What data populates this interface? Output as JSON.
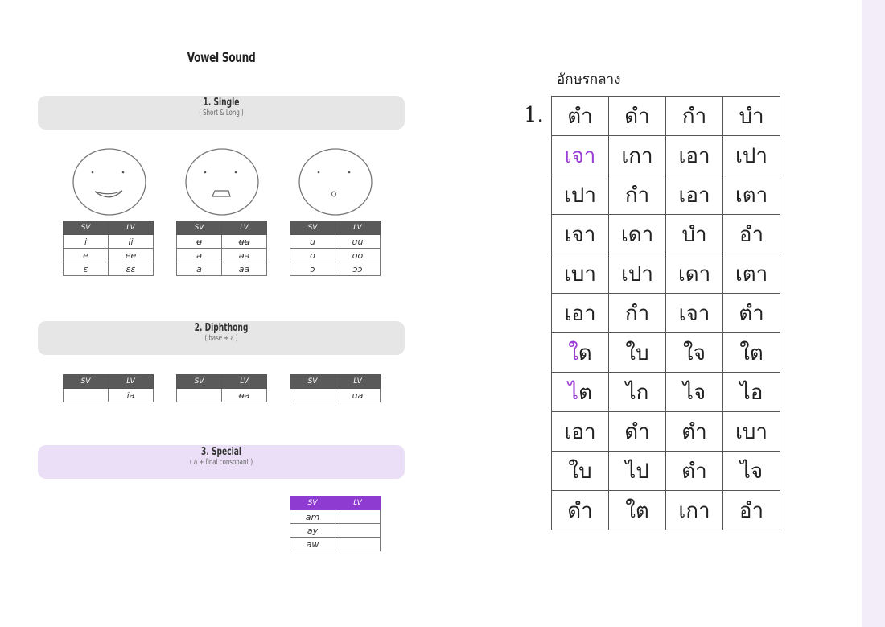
{
  "left": {
    "title": "Vowel Sound",
    "sections": [
      {
        "title": "1. Single",
        "subtitle": "( Short & Long )"
      },
      {
        "title": "2. Diphthong",
        "subtitle": "( base + a )"
      },
      {
        "title": "3. Special",
        "subtitle": "( a + final consonant )"
      }
    ],
    "single_tables": [
      {
        "header": [
          "SV",
          "LV"
        ],
        "rows": [
          [
            "i",
            "ii"
          ],
          [
            "e",
            "ee"
          ],
          [
            "ɛ",
            "ɛɛ"
          ]
        ]
      },
      {
        "header": [
          "SV",
          "LV"
        ],
        "rows": [
          [
            "ʉ",
            "ʉʉ"
          ],
          [
            "ə",
            "əə"
          ],
          [
            "a",
            "aa"
          ]
        ]
      },
      {
        "header": [
          "SV",
          "LV"
        ],
        "rows": [
          [
            "u",
            "uu"
          ],
          [
            "o",
            "oo"
          ],
          [
            "ɔ",
            "ɔɔ"
          ]
        ]
      }
    ],
    "diphthong_tables": [
      {
        "header": [
          "SV",
          "LV"
        ],
        "rows": [
          [
            "",
            "ia"
          ]
        ]
      },
      {
        "header": [
          "SV",
          "LV"
        ],
        "rows": [
          [
            "",
            "ʉa"
          ]
        ]
      },
      {
        "header": [
          "SV",
          "LV"
        ],
        "rows": [
          [
            "",
            "ua"
          ]
        ]
      }
    ],
    "special_table": {
      "header": [
        "SV",
        "LV"
      ],
      "rows": [
        [
          "am",
          ""
        ],
        [
          "ay",
          ""
        ],
        [
          "aw",
          ""
        ]
      ]
    }
  },
  "right": {
    "heading": "อักษรกลาง",
    "exercise_number": "1.",
    "grid": [
      [
        [
          "ต",
          "ำ"
        ],
        "ดำ",
        "กำ",
        "บำ"
      ],
      [
        [
          "",
          "เ",
          "จา"
        ],
        "เกา",
        "เอา",
        "เปา"
      ],
      [
        "เปา",
        "กำ",
        "เอา",
        "เตา"
      ],
      [
        "เจา",
        "เดา",
        "บำ",
        "อำ"
      ],
      [
        "เบา",
        "เปา",
        "เดา",
        "เตา"
      ],
      [
        "เอา",
        "กำ",
        "เจา",
        "ตำ"
      ],
      [
        [
          "",
          "ใ",
          "ด"
        ],
        "ใบ",
        "ใจ",
        "ใต"
      ],
      [
        [
          "",
          "ไ",
          "ต"
        ],
        "ไก",
        "ไจ",
        "ไอ"
      ],
      [
        "เอา",
        "ดำ",
        "ตำ",
        "เบา"
      ],
      [
        "ใบ",
        "ไป",
        "ตำ",
        "ไจ"
      ],
      [
        "ดำ",
        "ใต",
        "เกา",
        "อำ"
      ]
    ]
  },
  "colors": {
    "accent": "#9b3ed6",
    "header_gray": "#5a5a5a",
    "special_bar": "#eadff6"
  }
}
